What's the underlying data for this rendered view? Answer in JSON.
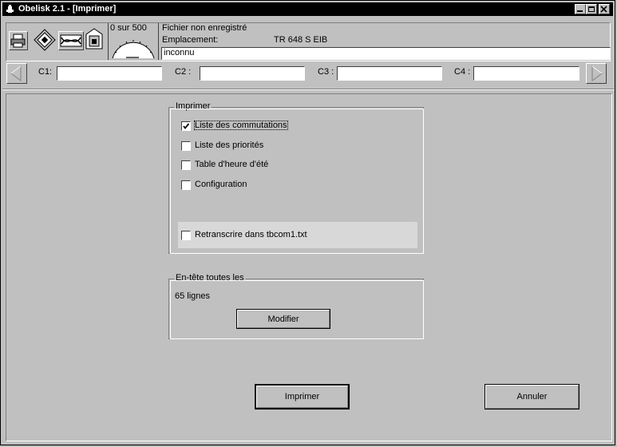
{
  "window": {
    "title": "Obelisk 2.1 - [Imprimer]",
    "controls": [
      "minimize",
      "restore",
      "close"
    ]
  },
  "toolbar": {
    "icons": [
      "printer-icon",
      "disk-icon",
      "cable-icon",
      "lock-icon"
    ],
    "counter_label": "0 sur 500",
    "status_line": "Fichier non enregistré",
    "location_label": "Emplacement:",
    "location_value": "TR 648 S EIB",
    "name_value": "inconnu"
  },
  "channels": [
    {
      "label": "C1:",
      "value": ""
    },
    {
      "label": "C2 :",
      "value": ""
    },
    {
      "label": "C3 :",
      "value": ""
    },
    {
      "label": "C4 :",
      "value": ""
    }
  ],
  "print_group": {
    "legend": "Imprimer",
    "options": [
      {
        "label": "Liste des commutations",
        "checked": true
      },
      {
        "label": "Liste des priorités",
        "checked": false
      },
      {
        "label": "Table d'heure d'été",
        "checked": false
      },
      {
        "label": "Configuration",
        "checked": false
      }
    ],
    "transcribe": {
      "label": "Retranscrire dans tbcom1.txt",
      "checked": false
    }
  },
  "header_group": {
    "legend": "En-tête toutes les",
    "value": "65 lignes",
    "modify_label": "Modifier"
  },
  "actions": {
    "print_label": "Imprimer",
    "cancel_label": "Annuler"
  }
}
